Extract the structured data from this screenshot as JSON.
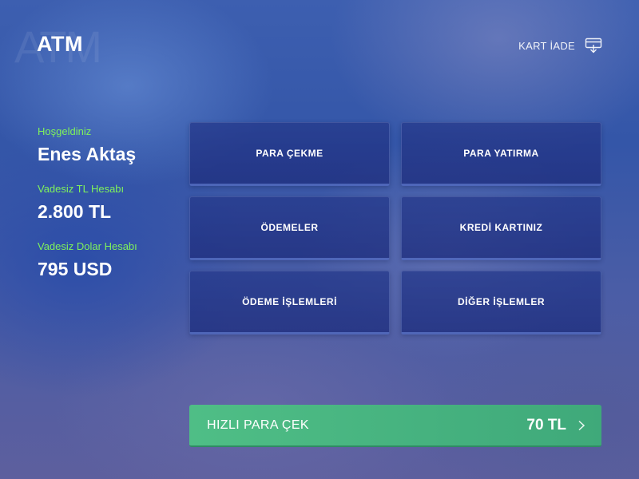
{
  "header": {
    "logo": "ATM",
    "card_return_label": "KART İADE"
  },
  "user": {
    "greeting": "Hoşgeldiniz",
    "name": "Enes Aktaş",
    "accounts": [
      {
        "label": "Vadesiz TL Hesabı",
        "balance": "2.800 TL"
      },
      {
        "label": "Vadesiz Dolar Hesabı",
        "balance": "795 USD"
      }
    ]
  },
  "menu": [
    {
      "label": "PARA ÇEKME"
    },
    {
      "label": "PARA YATIRMA"
    },
    {
      "label": "ÖDEMELER"
    },
    {
      "label": "KREDİ KARTINIZ"
    },
    {
      "label": "ÖDEME İŞLEMLERİ"
    },
    {
      "label": "DİĞER İŞLEMLER"
    }
  ],
  "quick_withdraw": {
    "label": "HIZLI PARA ÇEK",
    "amount": "70 TL"
  },
  "colors": {
    "accent_green_text": "#7ff25b",
    "quick_button": "#4fbe86",
    "menu_button": "#263a8c"
  },
  "icons": {
    "card_return": "card-eject-icon",
    "quick_arrow": "chevron-right-icon"
  }
}
